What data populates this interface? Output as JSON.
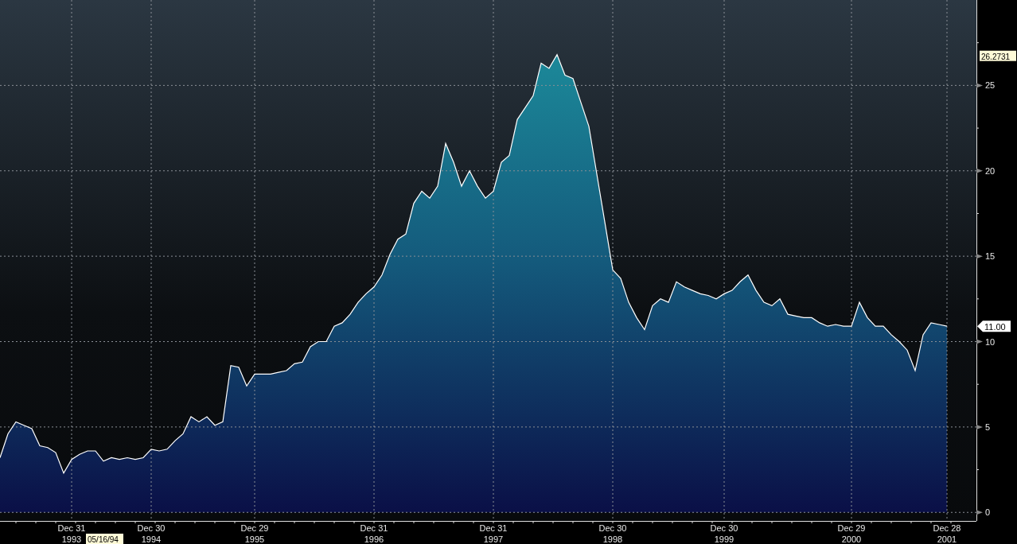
{
  "chart": {
    "high_label": "26.2731",
    "last_price": "11.00",
    "cursor_date": "05/16/94",
    "chart_data": {
      "type": "area",
      "grid": true,
      "ylim": [
        -0.5,
        30
      ],
      "yticks": [
        0,
        5,
        10,
        15,
        20,
        25
      ],
      "categories": [
        null,
        null,
        null,
        null,
        null,
        null,
        null,
        null,
        null,
        "Dec 31\n1993",
        null,
        null,
        null,
        null,
        null,
        null,
        null,
        null,
        null,
        "Dec 30\n1994",
        null,
        null,
        null,
        null,
        null,
        null,
        null,
        null,
        null,
        null,
        null,
        null,
        "Dec 29\n1995",
        null,
        null,
        null,
        null,
        null,
        null,
        null,
        null,
        null,
        null,
        null,
        null,
        null,
        null,
        "Dec 31\n1996",
        null,
        null,
        null,
        null,
        null,
        null,
        null,
        null,
        null,
        null,
        null,
        null,
        null,
        null,
        "Dec 31\n1997",
        null,
        null,
        null,
        null,
        null,
        null,
        null,
        null,
        null,
        null,
        null,
        null,
        null,
        null,
        "Dec 30\n1998",
        null,
        null,
        null,
        null,
        null,
        null,
        null,
        null,
        null,
        null,
        null,
        null,
        null,
        "Dec 30\n1999",
        null,
        null,
        null,
        null,
        null,
        null,
        null,
        null,
        null,
        null,
        null,
        null,
        null,
        null,
        null,
        "Dec 29\n2000",
        null,
        null,
        null,
        null,
        null,
        null,
        null,
        null,
        null,
        null,
        null,
        "Dec 28\n2001"
      ],
      "series": [
        {
          "color": "#ffffff",
          "values": [
            3.2,
            4.6,
            5.3,
            5.1,
            4.9,
            3.9,
            3.8,
            3.5,
            2.3,
            3.1,
            3.4,
            3.6,
            3.6,
            3.0,
            3.2,
            3.1,
            3.2,
            3.1,
            3.2,
            3.7,
            3.6,
            3.7,
            4.2,
            4.6,
            5.6,
            5.3,
            5.6,
            5.1,
            5.3,
            8.6,
            8.5,
            7.4,
            8.1,
            8.1,
            8.1,
            8.2,
            8.3,
            8.7,
            8.8,
            9.7,
            10.0,
            10.0,
            10.9,
            11.1,
            11.6,
            12.3,
            12.8,
            13.2,
            13.9,
            15.1,
            16.0,
            16.3,
            18.1,
            18.8,
            18.4,
            19.1,
            21.6,
            20.5,
            19.1,
            20.0,
            19.1,
            18.4,
            18.8,
            20.5,
            20.9,
            23.0,
            23.7,
            24.4,
            26.3,
            26.0,
            26.8,
            25.6,
            25.4,
            24.0,
            22.6,
            19.8,
            17.0,
            14.2,
            13.7,
            12.3,
            11.4,
            10.7,
            12.1,
            12.5,
            12.3,
            13.5,
            13.2,
            13.0,
            12.8,
            12.7,
            12.5,
            12.8,
            13.0,
            13.5,
            13.9,
            13.0,
            12.3,
            12.1,
            12.5,
            11.6,
            11.5,
            11.4,
            11.4,
            11.1,
            10.9,
            11.0,
            10.9,
            10.9,
            12.3,
            11.4,
            10.9,
            10.9,
            10.4,
            10.0,
            9.5,
            8.3,
            10.4,
            11.1,
            11.0,
            10.9
          ]
        }
      ]
    }
  }
}
